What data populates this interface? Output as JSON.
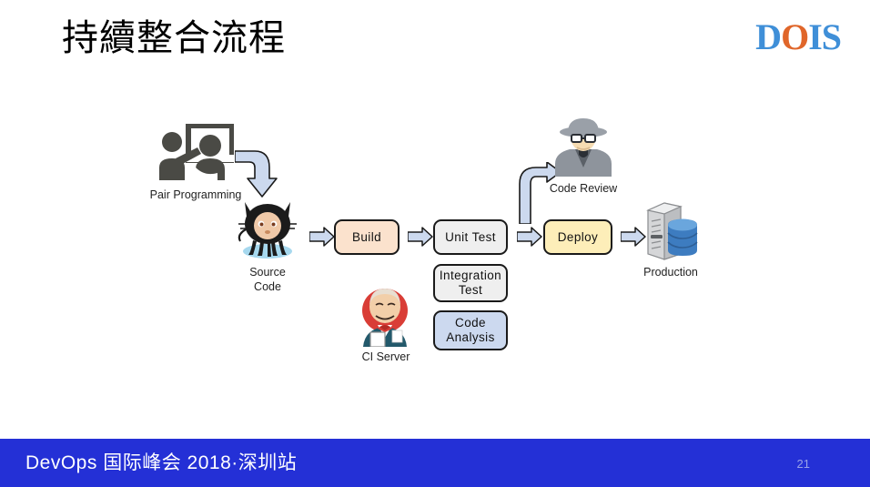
{
  "slide": {
    "title": "持續整合流程",
    "page_number": "21"
  },
  "logo": {
    "part1": "D",
    "part2": "O",
    "part3": "IS",
    "blue": "#3f8fd8",
    "orange": "#e0662a"
  },
  "footer": {
    "text": "DevOps 国际峰会 2018·深圳站",
    "background": "#2430d6"
  },
  "diagram": {
    "captions": {
      "pair_programming": "Pair Programming",
      "source_code": "Source\nCode",
      "ci_server": "CI Server",
      "code_review": "Code Review",
      "production": "Production"
    },
    "nodes": [
      {
        "id": "build",
        "label": "Build",
        "color": "#fbe2cd"
      },
      {
        "id": "unit-test",
        "label": "Unit Test",
        "color": "#efefef"
      },
      {
        "id": "integration-test",
        "label": "Integration\nTest",
        "color": "#efefef"
      },
      {
        "id": "code-analysis",
        "label": "Code\nAnalysis",
        "color": "#ccd9ef"
      },
      {
        "id": "deploy",
        "label": "Deploy",
        "color": "#fdeeb9"
      }
    ],
    "arrow_fill": "#ccd9ee",
    "arrow_stroke": "#1a1a1a"
  }
}
